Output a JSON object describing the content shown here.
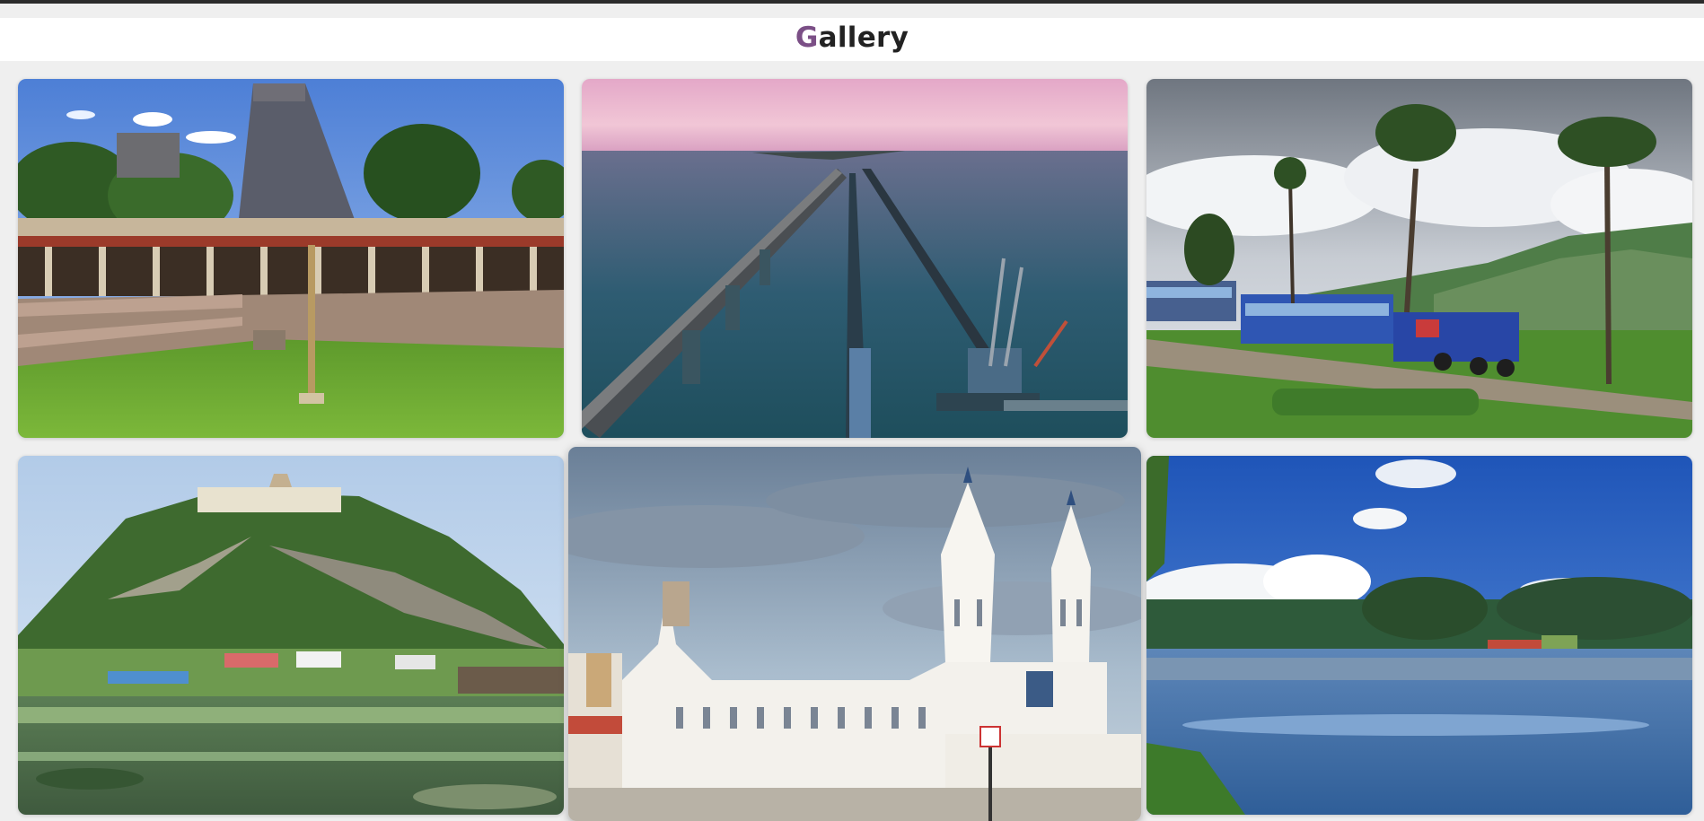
{
  "header": {
    "title_first_letter": "G",
    "title_rest": "allery",
    "accent_color": "#7b4f86"
  },
  "gallery": {
    "items": [
      {
        "icon": "temple-tank-image"
      },
      {
        "icon": "sea-bridge-image"
      },
      {
        "icon": "toy-train-image"
      },
      {
        "icon": "hill-temple-lake-image"
      },
      {
        "icon": "white-church-image"
      },
      {
        "icon": "mountain-lake-image"
      }
    ]
  }
}
